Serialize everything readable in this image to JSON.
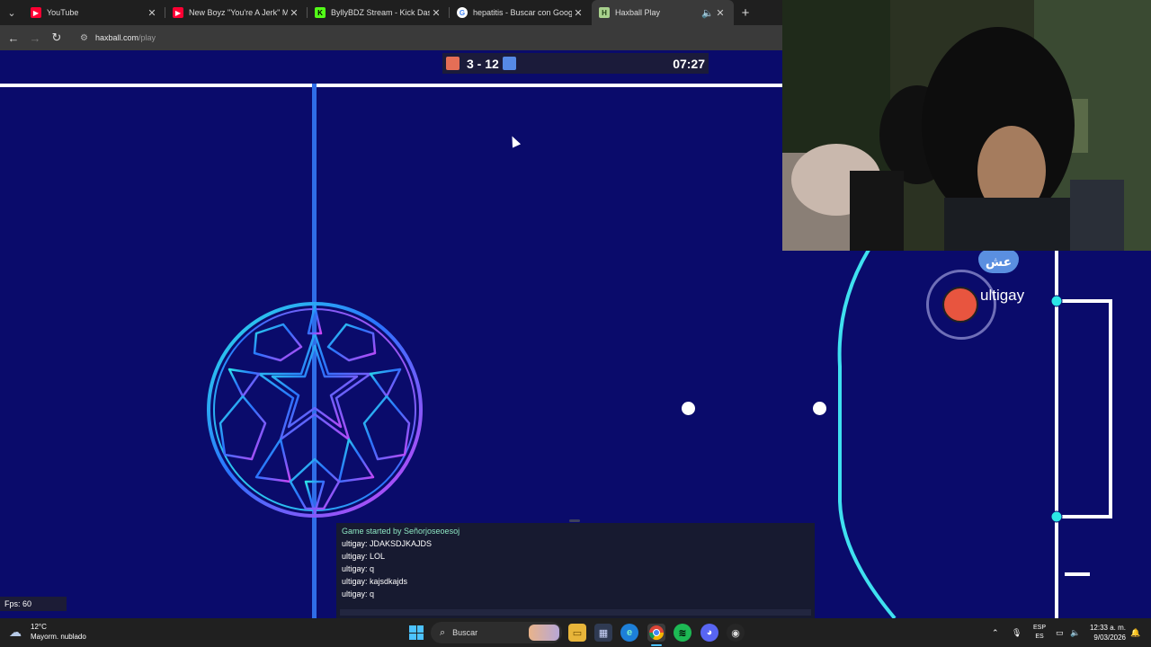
{
  "browser": {
    "tabs": [
      {
        "title": "YouTube",
        "icon": "youtube-icon",
        "color": "#ff0033"
      },
      {
        "title": "New Boyz \"You're A Jerk\" Music",
        "icon": "youtube-icon",
        "color": "#ff0033"
      },
      {
        "title": "ByllyBDZ Stream - Kick Dashbo",
        "icon": "kick-icon",
        "color": "#53fc18"
      },
      {
        "title": "hepatitis - Buscar con Google",
        "icon": "google-icon",
        "color": "#ffffff"
      },
      {
        "title": "Haxball Play",
        "icon": "haxball-icon",
        "color": "#a8d18d"
      }
    ],
    "url_host": "haxball.com",
    "url_path": "/play"
  },
  "game": {
    "score": "3 - 12",
    "timer": "07:27",
    "player_name": "ultigay",
    "avatar_text": "عش",
    "fps": "Fps: 60",
    "colors": {
      "red_team": "#e56e56",
      "blue_team": "#5689e5",
      "field": "#0a0b6b"
    },
    "chat": [
      {
        "text": "Game started by Señorjoseoesoj",
        "system": true
      },
      {
        "text": "ultigay: JDAKSDJKAJDS"
      },
      {
        "text": "ultigay: LOL"
      },
      {
        "text": "ultigay: q"
      },
      {
        "text": "ultigay: kajsdkajds"
      },
      {
        "text": "ultigay: q"
      }
    ]
  },
  "taskbar": {
    "temperature": "12°C",
    "weather": "Mayorm. nublado",
    "search_label": "Buscar",
    "lang_top": "ESP",
    "lang_bottom": "ES",
    "time": "12:33 a. m.",
    "date": "9/03/2026"
  }
}
